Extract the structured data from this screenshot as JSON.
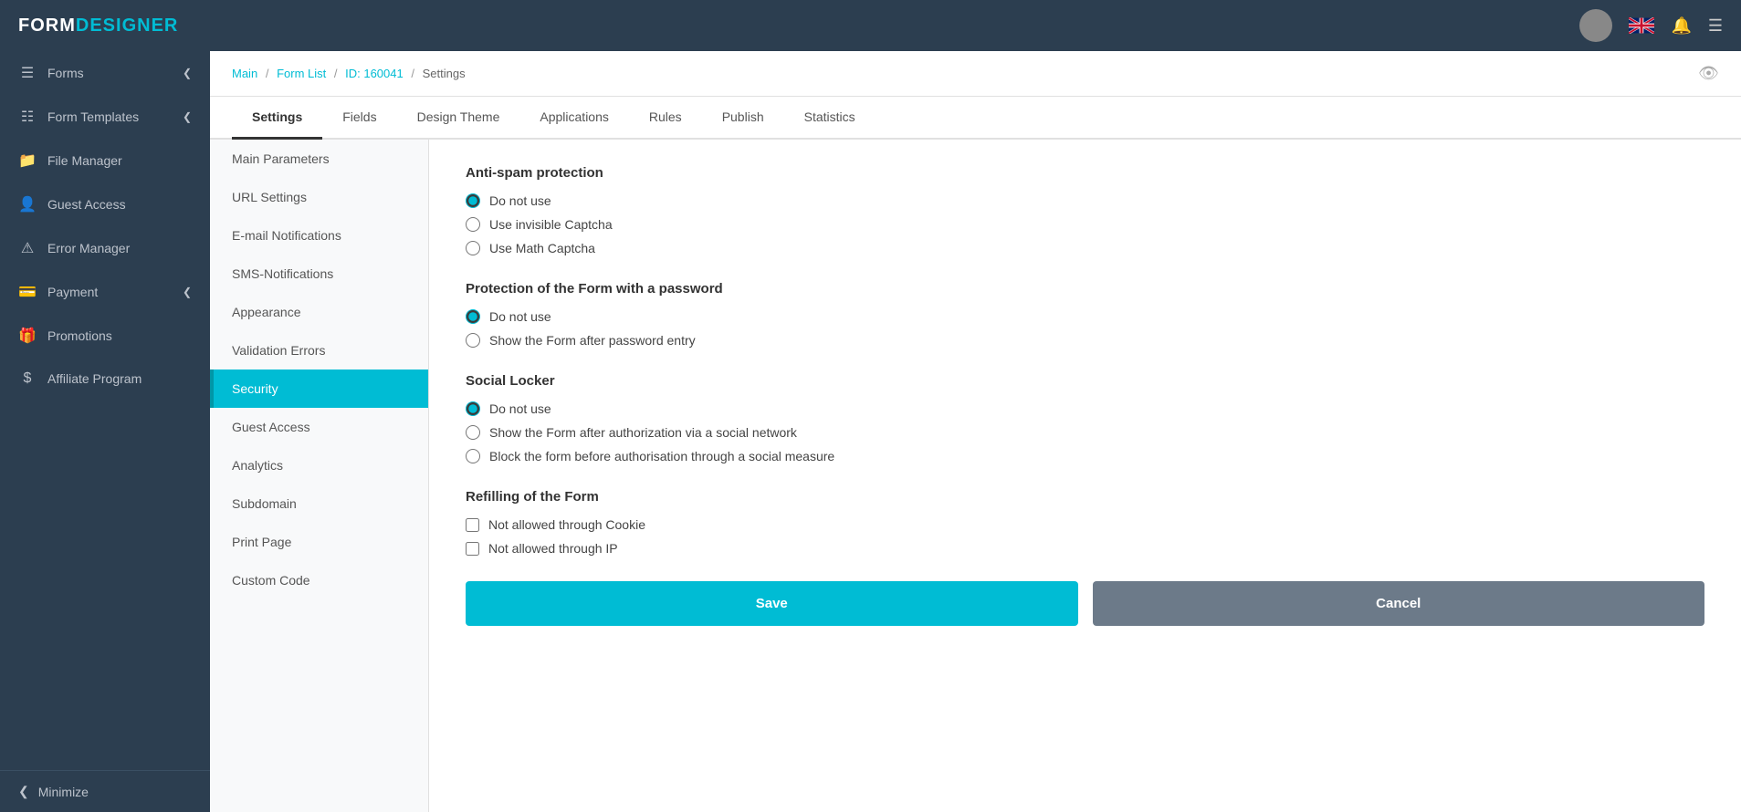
{
  "header": {
    "logo_form": "FORM",
    "logo_designer": "DESIGNER"
  },
  "breadcrumb": {
    "main": "Main",
    "form_list": "Form List",
    "id": "ID: 160041",
    "current": "Settings"
  },
  "tabs": [
    {
      "label": "Settings",
      "active": true
    },
    {
      "label": "Fields",
      "active": false
    },
    {
      "label": "Design Theme",
      "active": false
    },
    {
      "label": "Applications",
      "active": false
    },
    {
      "label": "Rules",
      "active": false
    },
    {
      "label": "Publish",
      "active": false
    },
    {
      "label": "Statistics",
      "active": false
    }
  ],
  "sidebar": {
    "items": [
      {
        "label": "Forms",
        "icon": "≡",
        "has_arrow": true
      },
      {
        "label": "Form Templates",
        "icon": "📄",
        "has_arrow": true
      },
      {
        "label": "File Manager",
        "icon": "📁",
        "has_arrow": false
      },
      {
        "label": "Guest Access",
        "icon": "👤",
        "has_arrow": false
      },
      {
        "label": "Error Manager",
        "icon": "⚠",
        "has_arrow": false
      },
      {
        "label": "Payment",
        "icon": "💳",
        "has_arrow": true
      },
      {
        "label": "Promotions",
        "icon": "🎁",
        "has_arrow": false
      },
      {
        "label": "Affiliate Program",
        "icon": "💰",
        "has_arrow": false
      }
    ],
    "minimize_label": "Minimize"
  },
  "left_nav": {
    "items": [
      {
        "label": "Main Parameters",
        "active": false
      },
      {
        "label": "URL Settings",
        "active": false
      },
      {
        "label": "E-mail Notifications",
        "active": false
      },
      {
        "label": "SMS-Notifications",
        "active": false
      },
      {
        "label": "Appearance",
        "active": false
      },
      {
        "label": "Validation Errors",
        "active": false
      },
      {
        "label": "Security",
        "active": true
      },
      {
        "label": "Guest Access",
        "active": false
      },
      {
        "label": "Analytics",
        "active": false
      },
      {
        "label": "Subdomain",
        "active": false
      },
      {
        "label": "Print Page",
        "active": false
      },
      {
        "label": "Custom Code",
        "active": false
      }
    ]
  },
  "security": {
    "anti_spam": {
      "title": "Anti-spam protection",
      "options": [
        {
          "label": "Do not use",
          "checked": true
        },
        {
          "label": "Use invisible Captcha",
          "checked": false
        },
        {
          "label": "Use Math Captcha",
          "checked": false
        }
      ]
    },
    "password_protection": {
      "title": "Protection of the Form with a password",
      "options": [
        {
          "label": "Do not use",
          "checked": true
        },
        {
          "label": "Show the Form after password entry",
          "checked": false
        }
      ]
    },
    "social_locker": {
      "title": "Social Locker",
      "options": [
        {
          "label": "Do not use",
          "checked": true
        },
        {
          "label": "Show the Form after authorization via a social network",
          "checked": false
        },
        {
          "label": "Block the form before authorisation through a social measure",
          "checked": false
        }
      ]
    },
    "refilling": {
      "title": "Refilling of the Form",
      "checkboxes": [
        {
          "label": "Not allowed through Cookie",
          "checked": false
        },
        {
          "label": "Not allowed through IP",
          "checked": false
        }
      ]
    }
  },
  "buttons": {
    "save": "Save",
    "cancel": "Cancel"
  }
}
